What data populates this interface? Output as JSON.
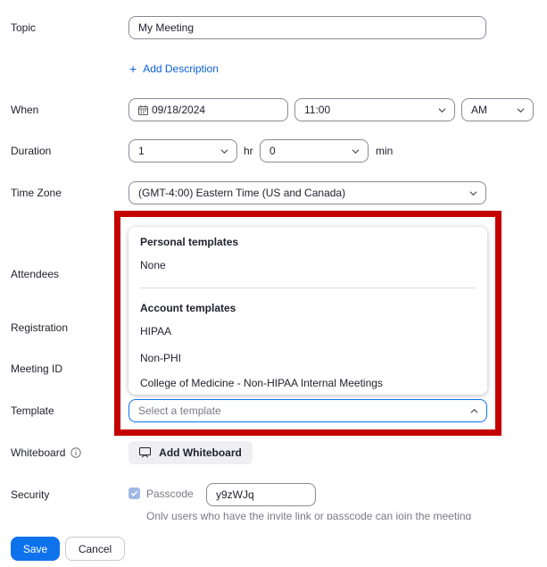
{
  "labels": {
    "topic": "Topic",
    "when": "When",
    "duration": "Duration",
    "time_zone": "Time Zone",
    "attendees": "Attendees",
    "registration": "Registration",
    "meeting_id": "Meeting ID",
    "template": "Template",
    "whiteboard": "Whiteboard",
    "security": "Security"
  },
  "topic": {
    "value": "My Meeting"
  },
  "add_description": {
    "label": "Add Description",
    "icon": "plus-icon"
  },
  "when": {
    "date": "09/18/2024",
    "time": "11:00",
    "ampm": "AM"
  },
  "duration": {
    "hours": "1",
    "hours_unit": "hr",
    "minutes": "0",
    "minutes_unit": "min"
  },
  "time_zone": {
    "value": "(GMT-4:00) Eastern Time (US and Canada)"
  },
  "template_dropdown": {
    "personal_heading": "Personal templates",
    "personal_options": [
      "None"
    ],
    "account_heading": "Account templates",
    "account_options": [
      "HIPAA",
      "Non-PHI",
      "College of Medicine - Non-HIPAA Internal Meetings"
    ]
  },
  "template": {
    "placeholder": "Select a template"
  },
  "whiteboard": {
    "button_label": "Add Whiteboard",
    "info_icon": "info-icon"
  },
  "security": {
    "passcode_label": "Passcode",
    "passcode_checked": true,
    "passcode_value": "y9zWJq",
    "note": "Only users who have the invite link or passcode can join the meeting"
  },
  "actions": {
    "save": "Save",
    "cancel": "Cancel"
  },
  "colors": {
    "accent": "#0e72ed",
    "link": "#0e5fd8",
    "highlight": "#c40000"
  }
}
